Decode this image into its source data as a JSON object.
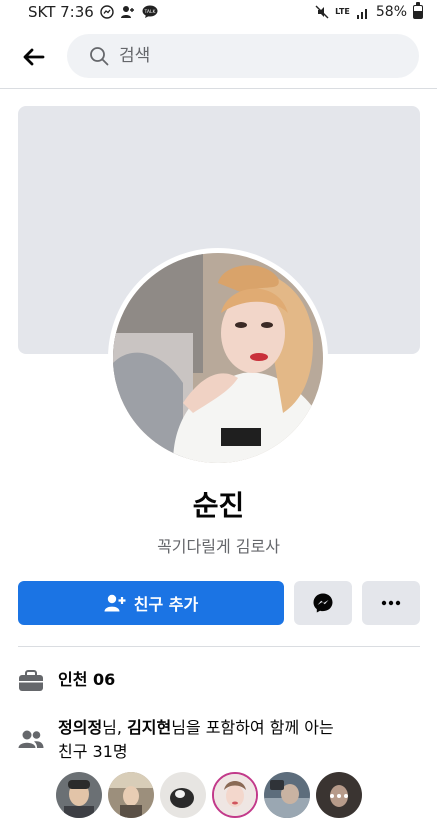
{
  "status_bar": {
    "carrier_time": "SKT 7:36",
    "network": "LTE",
    "battery": "58%",
    "battery_level": 0.58,
    "icons": [
      "messenger-icon",
      "person-add-icon",
      "talk-icon",
      "mute-icon",
      "lte-icon",
      "signal-icon",
      "battery-icon"
    ]
  },
  "header": {
    "back_icon": "back-arrow-icon",
    "search_icon": "search-icon",
    "search_placeholder": "검색"
  },
  "profile": {
    "name": "순진",
    "bio": "꼭기다릴게 김로사"
  },
  "actions": {
    "add_friend_label": "친구 추가",
    "add_friend_icon": "person-add-icon",
    "message_icon": "messenger-icon",
    "more_icon": "more-icon"
  },
  "details": {
    "work_icon": "briefcase-icon",
    "work_text": "인천 06",
    "mutual_icon": "friends-icon",
    "mutual_name1": "정의정",
    "mutual_suffix1": "님, ",
    "mutual_name2": "김지현",
    "mutual_suffix2": "님을 포함하여 함께 아는",
    "mutual_line2": "친구 31명"
  },
  "colors": {
    "primary": "#1b74e4",
    "secondary_bg": "#e4e6eb",
    "muted_text": "#65676b",
    "search_bg": "#f0f2f5"
  }
}
